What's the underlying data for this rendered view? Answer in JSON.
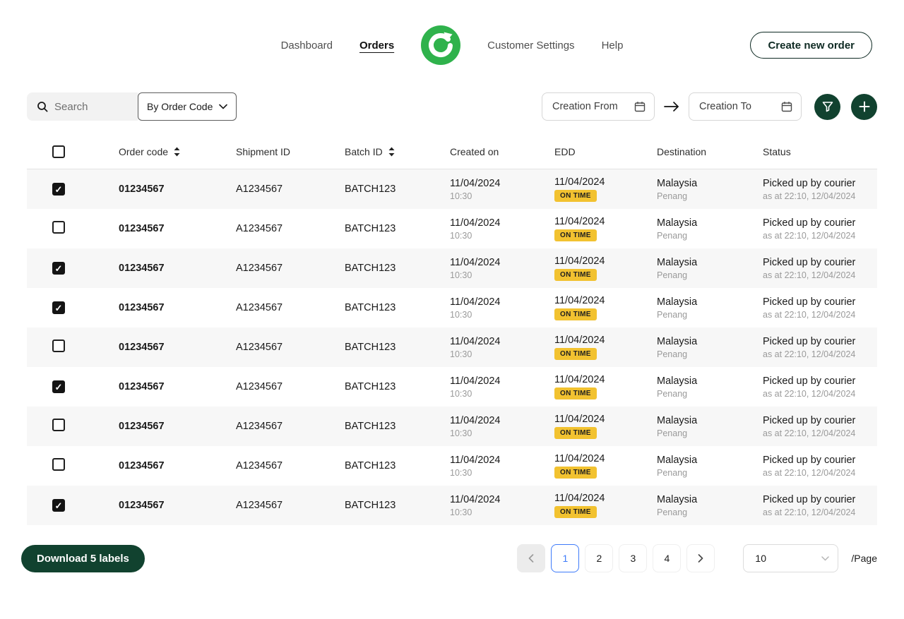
{
  "nav": {
    "items": [
      {
        "label": "Dashboard",
        "active": false
      },
      {
        "label": "Orders",
        "active": true
      },
      {
        "label": "Customer Settings",
        "active": false
      },
      {
        "label": "Help",
        "active": false
      }
    ],
    "create_button": "Create new order"
  },
  "filters": {
    "search_placeholder": "Search",
    "search_filter_dropdown": "By Order Code",
    "creation_from_placeholder": "Creation From",
    "creation_to_placeholder": "Creation To"
  },
  "table": {
    "columns": [
      {
        "label": "Order code",
        "sortable": true
      },
      {
        "label": "Shipment ID",
        "sortable": false
      },
      {
        "label": "Batch ID",
        "sortable": true
      },
      {
        "label": "Created on",
        "sortable": false
      },
      {
        "label": "EDD",
        "sortable": false
      },
      {
        "label": "Destination",
        "sortable": false
      },
      {
        "label": "Status",
        "sortable": false
      }
    ],
    "header_checkbox_checked": false,
    "rows": [
      {
        "checked": true,
        "order_code": "01234567",
        "shipment_id": "A1234567",
        "batch_id": "BATCH123",
        "created_date": "11/04/2024",
        "created_time": "10:30",
        "edd_date": "11/04/2024",
        "edd_badge": "ON TIME",
        "destination_country": "Malaysia",
        "destination_city": "Penang",
        "status": "Picked up by courier",
        "status_detail": "as at 22:10, 12/04/2024"
      },
      {
        "checked": false,
        "order_code": "01234567",
        "shipment_id": "A1234567",
        "batch_id": "BATCH123",
        "created_date": "11/04/2024",
        "created_time": "10:30",
        "edd_date": "11/04/2024",
        "edd_badge": "ON TIME",
        "destination_country": "Malaysia",
        "destination_city": "Penang",
        "status": "Picked up by courier",
        "status_detail": "as at 22:10, 12/04/2024"
      },
      {
        "checked": true,
        "order_code": "01234567",
        "shipment_id": "A1234567",
        "batch_id": "BATCH123",
        "created_date": "11/04/2024",
        "created_time": "10:30",
        "edd_date": "11/04/2024",
        "edd_badge": "ON TIME",
        "destination_country": "Malaysia",
        "destination_city": "Penang",
        "status": "Picked up by courier",
        "status_detail": "as at 22:10, 12/04/2024"
      },
      {
        "checked": true,
        "order_code": "01234567",
        "shipment_id": "A1234567",
        "batch_id": "BATCH123",
        "created_date": "11/04/2024",
        "created_time": "10:30",
        "edd_date": "11/04/2024",
        "edd_badge": "ON TIME",
        "destination_country": "Malaysia",
        "destination_city": "Penang",
        "status": "Picked up by courier",
        "status_detail": "as at 22:10, 12/04/2024"
      },
      {
        "checked": false,
        "order_code": "01234567",
        "shipment_id": "A1234567",
        "batch_id": "BATCH123",
        "created_date": "11/04/2024",
        "created_time": "10:30",
        "edd_date": "11/04/2024",
        "edd_badge": "ON TIME",
        "destination_country": "Malaysia",
        "destination_city": "Penang",
        "status": "Picked up by courier",
        "status_detail": "as at 22:10, 12/04/2024"
      },
      {
        "checked": true,
        "order_code": "01234567",
        "shipment_id": "A1234567",
        "batch_id": "BATCH123",
        "created_date": "11/04/2024",
        "created_time": "10:30",
        "edd_date": "11/04/2024",
        "edd_badge": "ON TIME",
        "destination_country": "Malaysia",
        "destination_city": "Penang",
        "status": "Picked up by courier",
        "status_detail": "as at 22:10, 12/04/2024"
      },
      {
        "checked": false,
        "order_code": "01234567",
        "shipment_id": "A1234567",
        "batch_id": "BATCH123",
        "created_date": "11/04/2024",
        "created_time": "10:30",
        "edd_date": "11/04/2024",
        "edd_badge": "ON TIME",
        "destination_country": "Malaysia",
        "destination_city": "Penang",
        "status": "Picked up by courier",
        "status_detail": "as at 22:10, 12/04/2024"
      },
      {
        "checked": false,
        "order_code": "01234567",
        "shipment_id": "A1234567",
        "batch_id": "BATCH123",
        "created_date": "11/04/2024",
        "created_time": "10:30",
        "edd_date": "11/04/2024",
        "edd_badge": "ON TIME",
        "destination_country": "Malaysia",
        "destination_city": "Penang",
        "status": "Picked up by courier",
        "status_detail": "as at 22:10, 12/04/2024"
      },
      {
        "checked": true,
        "order_code": "01234567",
        "shipment_id": "A1234567",
        "batch_id": "BATCH123",
        "created_date": "11/04/2024",
        "created_time": "10:30",
        "edd_date": "11/04/2024",
        "edd_badge": "ON TIME",
        "destination_country": "Malaysia",
        "destination_city": "Penang",
        "status": "Picked up by courier",
        "status_detail": "as at 22:10, 12/04/2024"
      }
    ]
  },
  "footer": {
    "download_button": "Download 5 labels",
    "pagination": {
      "pages": [
        "1",
        "2",
        "3",
        "4"
      ],
      "active_page": "1"
    },
    "page_size": "10",
    "per_page_label": "/Page"
  },
  "colors": {
    "primary_dark_green": "#11422F",
    "logo_green": "#2FB24C",
    "badge_yellow": "#F2C230",
    "active_page_blue": "#3E7BFA"
  }
}
